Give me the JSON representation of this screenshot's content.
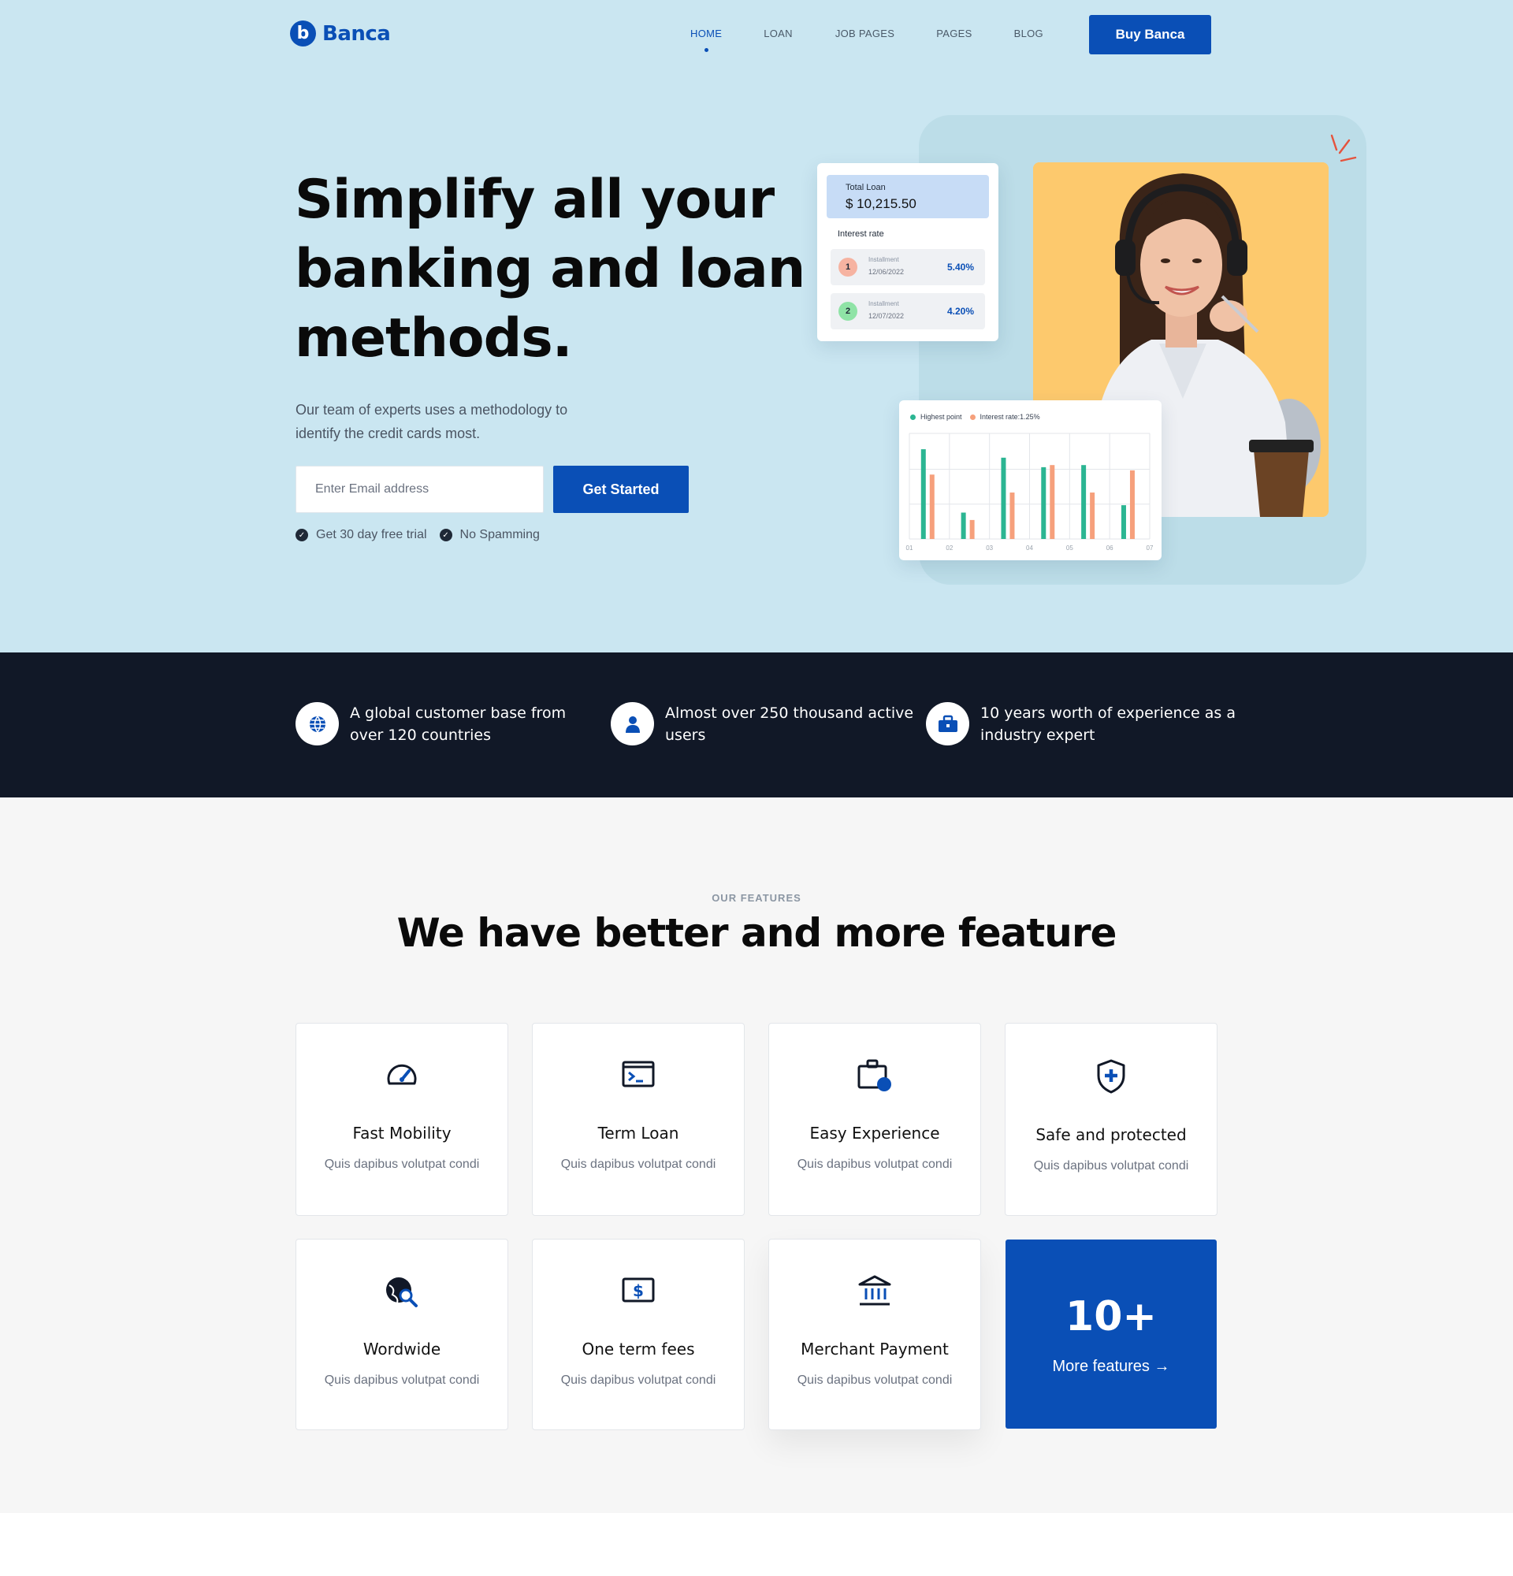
{
  "brand": {
    "name": "Banca",
    "logo_letter": "b",
    "primary_color": "#0a4fb6"
  },
  "nav": {
    "items": [
      {
        "label": "HOME",
        "active": true
      },
      {
        "label": "LOAN"
      },
      {
        "label": "JOB PAGES"
      },
      {
        "label": "PAGES"
      },
      {
        "label": "BLOG"
      }
    ],
    "cta_label": "Buy Banca"
  },
  "hero": {
    "title_lines": [
      "Simplify all your",
      "banking and loan",
      "methods."
    ],
    "subtitle_lines": [
      "Our team of experts uses a methodology to",
      "identify the credit cards most."
    ],
    "email_placeholder": "Enter Email address",
    "cta_label": "Get Started",
    "perks": [
      "Get 30 day free trial",
      "No Spamming"
    ]
  },
  "loan_card": {
    "total_label": "Total Loan",
    "total_amount": "$ 10,215.50",
    "interest_label": "Interest rate",
    "installments": [
      {
        "num": "1",
        "label": "Installment",
        "date": "12/06/2022",
        "rate": "5.40%",
        "color": "#f6b3a1"
      },
      {
        "num": "2",
        "label": "Installment",
        "date": "12/07/2022",
        "rate": "4.20%",
        "color": "#8fe3a6"
      }
    ]
  },
  "chart_data": {
    "type": "bar",
    "categories": [
      "01",
      "02",
      "03",
      "04",
      "05",
      "06",
      "07"
    ],
    "series": [
      {
        "name": "Highest point",
        "color": "#2bb592",
        "values": [
          [
            8.5
          ],
          [
            2.5
          ],
          [
            7.7
          ],
          [
            6.8
          ],
          [
            7.0
          ],
          [
            3.2
          ],
          []
        ]
      },
      {
        "name": "Interest rate:1.25%",
        "color": "#f6a07c",
        "values": [
          [
            6.1
          ],
          [
            1.8
          ],
          [
            4.4
          ],
          [
            7.0
          ],
          [
            4.4
          ],
          [
            6.5
          ],
          []
        ]
      }
    ],
    "ylim": [
      0,
      10
    ],
    "grid": true,
    "legend": "top-left"
  },
  "stats": [
    {
      "icon": "globe-icon",
      "text_lines": [
        "A global customer base from",
        "over 120 countries"
      ]
    },
    {
      "icon": "user-icon",
      "text_lines": [
        "Almost over 250 thousand active",
        "users"
      ]
    },
    {
      "icon": "briefcase-icon",
      "text_lines": [
        "10 years worth of experience as a",
        "industry expert"
      ]
    }
  ],
  "features": {
    "eyebrow": "OUR FEATURES",
    "title": "We have better and more feature",
    "cards": [
      {
        "icon": "speedometer-icon",
        "title": "Fast Mobility",
        "desc": "Quis dapibus volutpat condi"
      },
      {
        "icon": "terminal-icon",
        "title": "Term Loan",
        "desc": "Quis dapibus volutpat condi"
      },
      {
        "icon": "briefcase-dot-icon",
        "title": "Easy Experience",
        "desc": "Quis dapibus volutpat condi"
      },
      {
        "icon": "shield-plus-icon",
        "title": "Safe and protected",
        "desc": "Quis dapibus volutpat condi"
      },
      {
        "icon": "globe-search-icon",
        "title": "Wordwide",
        "desc": "Quis dapibus volutpat condi"
      },
      {
        "icon": "dollar-card-icon",
        "title": "One term fees",
        "desc": "Quis dapibus volutpat condi"
      },
      {
        "icon": "bank-icon",
        "title": "Merchant Payment",
        "desc": "Quis dapibus volutpat condi"
      }
    ],
    "more": {
      "count": "10+",
      "label": "More features →"
    }
  }
}
